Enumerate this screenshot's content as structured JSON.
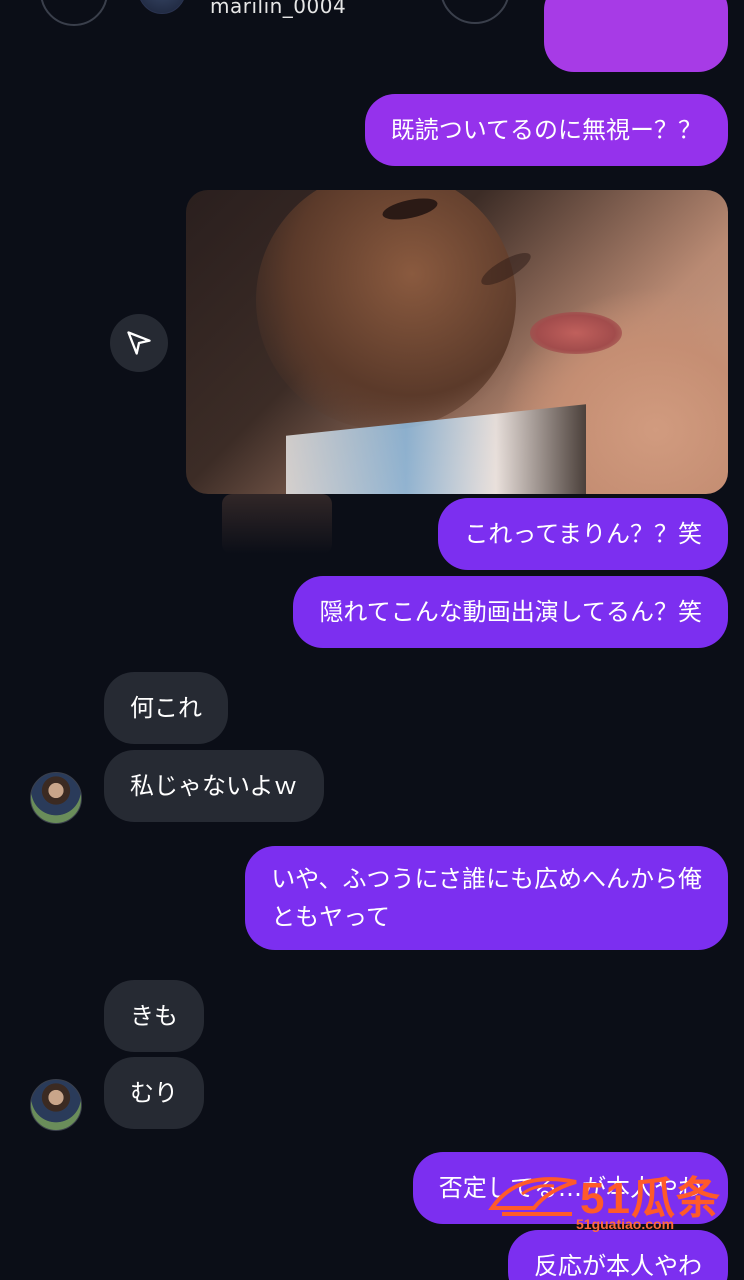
{
  "header": {
    "username": "marilin_0004",
    "icons": [
      "back-icon",
      "profile-avatar",
      "phone-icon",
      "video-icon",
      "info-icon"
    ]
  },
  "colors": {
    "background": "#0b0e17",
    "outgoing_bubble": "#7c2ff0",
    "incoming_bubble": "#262a33",
    "watermark": "#ff5a2a"
  },
  "messages": [
    {
      "direction": "outgoing",
      "text": "既読ついてるのに無視ー？？"
    },
    {
      "direction": "outgoing",
      "type": "video",
      "text": ""
    },
    {
      "direction": "outgoing",
      "text": "これってまりん？？笑"
    },
    {
      "direction": "outgoing",
      "text": "隠れてこんな動画出演してるん？笑"
    },
    {
      "direction": "incoming",
      "text": "何これ"
    },
    {
      "direction": "incoming",
      "text": "私じゃないよｗ"
    },
    {
      "direction": "outgoing",
      "lines": [
        "いや、ふつうにさ誰にも広めへんから俺",
        "ともヤって"
      ]
    },
    {
      "direction": "incoming",
      "text": "きも"
    },
    {
      "direction": "incoming",
      "text": "むり"
    },
    {
      "direction": "outgoing",
      "text": "否定してる…が本人やわ"
    },
    {
      "direction": "outgoing",
      "text": "反応が本人やわ"
    }
  ],
  "watermark": {
    "title": "51瓜条",
    "subtitle": "51guatiao.com"
  }
}
